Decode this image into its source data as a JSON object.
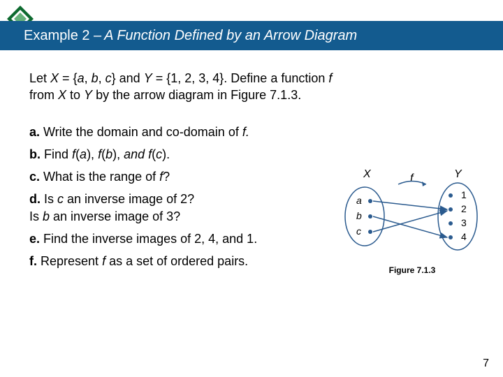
{
  "title": {
    "prefix": "Example 2 –",
    "name": "A Function Defined by an Arrow Diagram"
  },
  "intro": {
    "p1a": "Let ",
    "p1b": "X",
    "p1c": " = {",
    "p1d": "a",
    "p1e": ", ",
    "p1f": "b",
    "p1g": ", ",
    "p1h": "c",
    "p1i": "} and ",
    "p1j": "Y",
    "p1k": " = {1, 2, 3, 4}. Define a function ",
    "p1l": "f",
    "p2a": "from ",
    "p2b": "X",
    "p2c": " to ",
    "p2d": "Y",
    "p2e": " by the arrow diagram in Figure 7.1.3."
  },
  "items": {
    "a": {
      "lead": "a.",
      "t1": " Write the domain and co-domain of ",
      "t2": "f.",
      "rest": ""
    },
    "b": {
      "lead": "b.",
      "t1": " Find ",
      "fa1": "f",
      "fa2": "(",
      "fa3": "a",
      "fa4": "), ",
      "fb1": "f",
      "fb2": "(",
      "fb3": "b",
      "fb4": "), ",
      "mid": "and ",
      "fc1": "f",
      "fc2": "(",
      "fc3": "c",
      "fc4": ")."
    },
    "c": {
      "lead": "c.",
      "t1": " What is the range of ",
      "t2": "f",
      "t3": "?"
    },
    "d": {
      "lead": "d.",
      "t1": " Is ",
      "t2": "c",
      "t3": " an inverse image of 2?",
      "line2a": "Is ",
      "line2b": "b",
      "line2c": " an inverse image of 3?"
    },
    "e": {
      "lead": "e.",
      "t1": " Find the inverse images of 2, 4, and 1."
    },
    "f": {
      "lead": "f.",
      "t1": " Represent ",
      "t2": "f",
      "t3": " as a set of ordered pairs."
    }
  },
  "figure": {
    "caption": "Figure 7.1.3",
    "labels": {
      "X": "X",
      "Y": "Y",
      "f": "f",
      "a": "a",
      "b": "b",
      "c": "c",
      "n1": "1",
      "n2": "2",
      "n3": "3",
      "n4": "4"
    }
  },
  "page": "7"
}
